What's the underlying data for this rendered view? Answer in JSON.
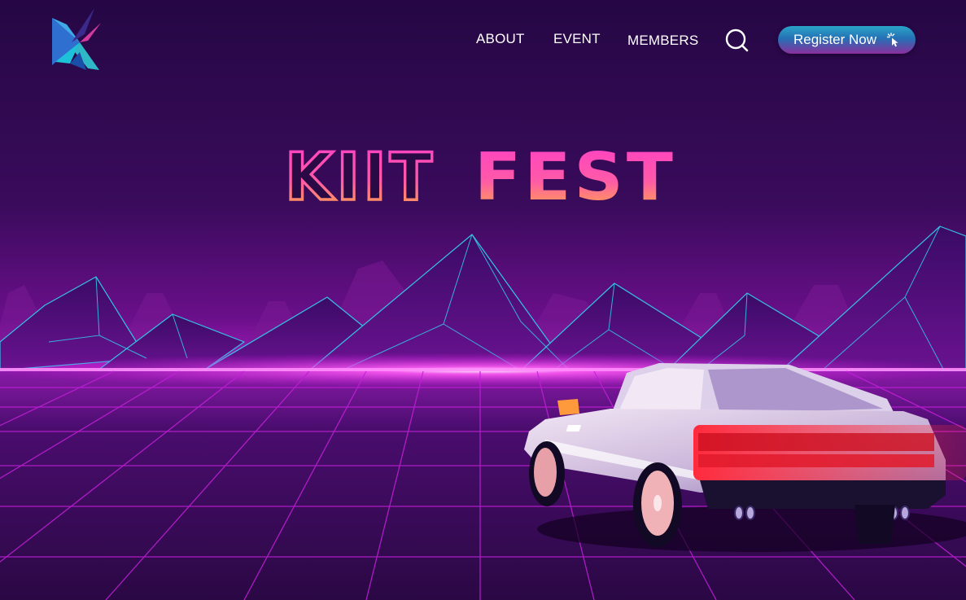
{
  "nav": {
    "links": [
      "ABOUT",
      "EVENT",
      "MEMBERS"
    ],
    "register_label": "Register Now"
  },
  "hero": {
    "title_word1": "KIIT",
    "title_word2": "FEST"
  },
  "icons": {
    "logo": "kiit-logo-icon",
    "search": "search-icon",
    "register": "pointer-click-icon"
  },
  "colors": {
    "background": "#2a0a44",
    "horizon_glow": "#ff3cf0",
    "grid_line": "#c21fd8",
    "mountain_line": "#36c2e6",
    "title_gradient_top": "#ff3fc6",
    "title_gradient_bottom": "#ffb13a",
    "button_top": "#2aa4c8",
    "button_bottom": "#8a2f9e"
  }
}
